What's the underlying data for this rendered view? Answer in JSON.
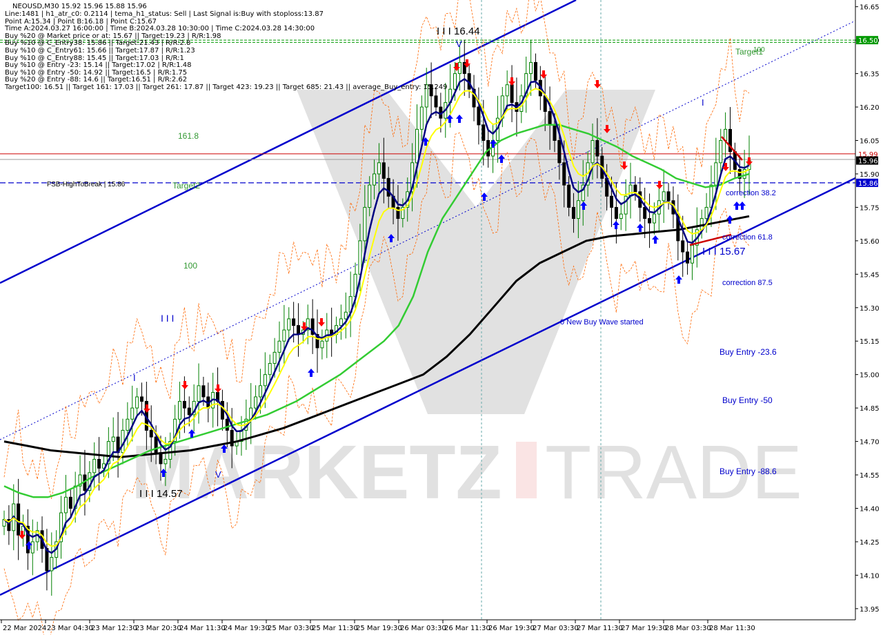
{
  "header": {
    "symbol_line": "NEOUSD,M30  15.92 15.96 15.88 15.96"
  },
  "info_lines": [
    "Line:1481 | h1_atr_c0: 0.2114 | tema_h1_status: Sell | Last Signal is:Buy with stoploss:13.87",
    "Point A:15.34 | Point B:16.18 | Point C:15.67",
    "Time A:2024.03.27 16:00:00 | Time B:2024.03.28 10:30:00 | Time C:2024.03.28 14:30:00",
    "Buy %20 @ Market price or at: 15.67 || Target:19.23 | R/R:1.98",
    "Buy %10 @ C_Entry38: 15.86 || Target:21.43 | R/R:2.8",
    "Buy %10 @ C_Entry61: 15.66 || Target:17.87 | R/R:1.23",
    "Buy %10 @ C_Entry88: 15.45 || Target:17.03 | R/R:1",
    "Buy %10 @ Entry -23: 15.14 || Target:17.02 | R/R:1.48",
    "Buy %10 @ Entry -50: 14.92 || Target:16.5 | R/R:1.75",
    "Buy %20 @ Entry -88: 14.6 || Target:16.51 | R/R:2.62",
    "Target100: 16.51 || Target 161: 17.03 || Target 261: 17.87 || Target 423: 19.23 || Target 685: 21.43 || average_Buy_entry: 15.249"
  ],
  "annotations": {
    "high_label": "I I I 16.44",
    "low_label": "I I I 14.57",
    "c_label": "I I I 15.67",
    "level_1618": "161.8",
    "level_100": "100",
    "target1": "Target1",
    "target2": "Target2",
    "target100": "100",
    "fsb": "FSB-HighToBreak | 15.86",
    "corr382": "correction 38.2",
    "corr618": "correction 61.8",
    "corr875": "correction 87.5",
    "buy236": "Buy Entry -23.6",
    "buy50": "Buy Entry -50",
    "buy886": "Buy Entry -88.6",
    "wave": "0 New Buy Wave started",
    "triple_a": "I I I",
    "single_a": "I",
    "single_b": "I",
    "v_mark_1": "V",
    "v_mark_2": "V",
    "watermark": "MARKETZ I TRADE"
  },
  "colors": {
    "up_candle": "#008000",
    "down_candle": "#000000",
    "channel": "#0000cc",
    "ema_green": "#33cc33",
    "ema_yellow": "#ffff00",
    "ema_navy": "#000080",
    "sma_black": "#000000",
    "red_line": "#cc0000",
    "green_dash": "#009900",
    "price_badge": "#000000",
    "target_badge": "#009900",
    "fsb_badge": "#0000cc"
  },
  "chart_data": {
    "type": "candlestick",
    "symbol": "NEOUSD",
    "timeframe": "M30",
    "ylim": [
      13.9,
      16.68
    ],
    "y_ticks": [
      "16.65",
      "16.50",
      "16.35",
      "16.20",
      "16.05",
      "15.90",
      "15.75",
      "15.60",
      "15.45",
      "15.30",
      "15.15",
      "15.00",
      "14.85",
      "14.70",
      "14.55",
      "14.40",
      "14.25",
      "14.10",
      "13.95"
    ],
    "x_ticks": [
      "22 Mar 2024",
      "23 Mar 04:30",
      "23 Mar 12:30",
      "23 Mar 20:30",
      "24 Mar 11:30",
      "24 Mar 19:30",
      "25 Mar 03:30",
      "25 Mar 11:30",
      "25 Mar 19:30",
      "26 Mar 03:30",
      "26 Mar 11:30",
      "26 Mar 19:30",
      "27 Mar 03:30",
      "27 Mar 11:30",
      "27 Mar 19:30",
      "28 Mar 03:30",
      "28 Mar 11:30"
    ],
    "price_levels": {
      "current": "15.96",
      "red_level": "15.99",
      "fsb": "15.86",
      "target": "16.50"
    },
    "close_series": [
      14.35,
      14.3,
      14.42,
      14.28,
      14.32,
      14.2,
      14.25,
      14.3,
      14.22,
      14.12,
      14.18,
      14.25,
      14.38,
      14.45,
      14.4,
      14.5,
      14.55,
      14.48,
      14.56,
      14.62,
      14.58,
      14.6,
      14.7,
      14.72,
      14.65,
      14.75,
      14.8,
      14.85,
      14.9,
      14.88,
      14.75,
      14.72,
      14.65,
      14.6,
      14.62,
      14.7,
      14.8,
      14.88,
      14.85,
      14.82,
      14.88,
      14.95,
      14.9,
      14.85,
      14.92,
      14.88,
      14.8,
      14.75,
      14.68,
      14.7,
      14.75,
      14.8,
      14.85,
      14.9,
      14.95,
      15.0,
      15.05,
      15.1,
      15.15,
      15.2,
      15.25,
      15.22,
      15.18,
      15.2,
      15.25,
      15.18,
      15.12,
      15.15,
      15.2,
      15.18,
      15.22,
      15.25,
      15.28,
      15.35,
      15.45,
      15.6,
      15.75,
      15.85,
      15.9,
      15.95,
      15.88,
      15.8,
      15.75,
      15.7,
      15.75,
      15.82,
      15.95,
      16.1,
      16.2,
      16.3,
      16.25,
      16.2,
      16.15,
      16.22,
      16.28,
      16.35,
      16.4,
      16.35,
      16.28,
      16.2,
      16.12,
      16.05,
      15.98,
      16.05,
      16.15,
      16.25,
      16.3,
      16.22,
      16.18,
      16.25,
      16.35,
      16.4,
      16.32,
      16.25,
      16.18,
      16.12,
      16.05,
      15.95,
      15.85,
      15.75,
      15.7,
      15.78,
      15.85,
      15.95,
      16.05,
      15.98,
      15.88,
      15.8,
      15.75,
      15.7,
      15.72,
      15.8,
      15.85,
      15.82,
      15.75,
      15.7,
      15.68,
      15.72,
      15.78,
      15.82,
      15.78,
      15.72,
      15.6,
      15.55,
      15.5,
      15.58,
      15.65,
      15.7,
      15.75,
      15.85,
      15.95,
      16.05,
      16.1,
      16.0,
      15.92,
      15.88,
      15.92,
      15.96
    ],
    "ema_green": [
      14.5,
      14.47,
      14.45,
      14.45,
      14.47,
      14.5,
      14.54,
      14.57,
      14.6,
      14.63,
      14.66,
      14.68,
      14.7,
      14.72,
      14.74,
      14.76,
      14.78,
      14.8,
      14.82,
      14.85,
      14.88,
      14.92,
      14.96,
      15.0,
      15.05,
      15.1,
      15.15,
      15.22,
      15.35,
      15.55,
      15.7,
      15.8,
      15.9,
      16.0,
      16.05,
      16.08,
      16.1,
      16.12,
      16.12,
      16.1,
      16.08,
      16.05,
      16.02,
      15.98,
      15.95,
      15.92,
      15.88,
      15.86,
      15.84,
      15.85,
      15.88,
      15.9
    ],
    "sma_black": [
      14.7,
      14.68,
      14.66,
      14.65,
      14.64,
      14.63,
      14.64,
      14.65,
      14.66,
      14.68,
      14.7,
      14.73,
      14.76,
      14.8,
      14.84,
      14.88,
      14.92,
      14.96,
      15.0,
      15.08,
      15.18,
      15.3,
      15.42,
      15.5,
      15.55,
      15.6,
      15.62,
      15.63,
      15.64,
      15.65,
      15.67,
      15.69,
      15.71
    ]
  }
}
